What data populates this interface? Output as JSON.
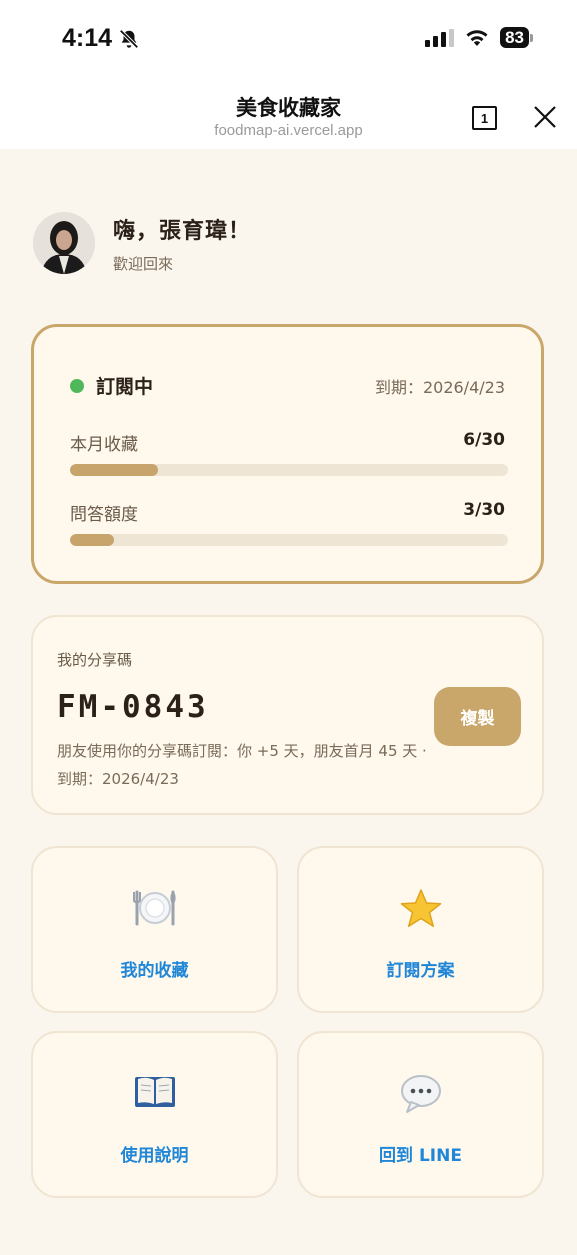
{
  "status_bar": {
    "time": "4:14",
    "battery": "83"
  },
  "nav": {
    "title": "美食收藏家",
    "url": "foodmap-ai.vercel.app",
    "tab_count": "1"
  },
  "greeting": {
    "title": "嗨，張育瑋！",
    "subtitle": "歡迎回來"
  },
  "subscription": {
    "status": "訂閱中",
    "expiry": "到期：2026/4/23",
    "metrics": [
      {
        "label": "本月收藏",
        "value": "6/30",
        "fraction": 0.2
      },
      {
        "label": "問答額度",
        "value": "3/30",
        "fraction": 0.1
      }
    ],
    "colors": {
      "accent": "#c9a66a",
      "status_dot": "#4fb85a"
    }
  },
  "share": {
    "label": "我的分享碼",
    "code": "FM-0843",
    "copy_label": "複製",
    "description": "朋友使用你的分享碼訂閱：你 +5 天，朋友首月 45 天 · 到期：2026/4/23"
  },
  "tiles": [
    {
      "label": "我的收藏",
      "icon": "plate-cutlery-icon"
    },
    {
      "label": "訂閱方案",
      "icon": "star-icon"
    },
    {
      "label": "使用說明",
      "icon": "open-book-icon"
    },
    {
      "label": "回到 LINE",
      "icon": "speech-bubble-icon"
    }
  ]
}
